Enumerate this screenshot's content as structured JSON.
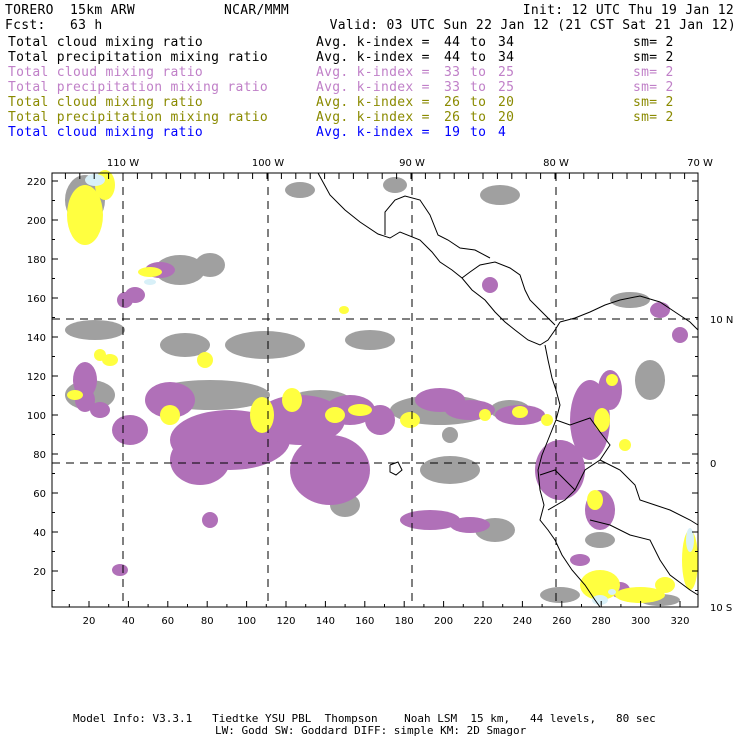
{
  "header": {
    "model": "TORERO  15km ARW",
    "org": "NCAR/MMM",
    "init": "Init: 12 UTC Thu 19 Jan 12",
    "fcst": "Fcst:   63 h",
    "valid": "Valid: 03 UTC Sun 22 Jan 12 (21 CST Sat 21 Jan 12)"
  },
  "legend": [
    {
      "field": "Total cloud mixing ratio",
      "avg": "Avg. k-index =",
      "from": "44",
      "to_word": "to",
      "to": "34",
      "sm": "sm= 2",
      "color": "#000000"
    },
    {
      "field": "Total precipitation mixing ratio",
      "avg": "Avg. k-index =",
      "from": "44",
      "to_word": "to",
      "to": "34",
      "sm": "sm= 2",
      "color": "#000000"
    },
    {
      "field": "Total cloud mixing ratio",
      "avg": "Avg. k-index =",
      "from": "33",
      "to_word": "to",
      "to": "25",
      "sm": "sm= 2",
      "color": "#c080c8"
    },
    {
      "field": "Total precipitation mixing ratio",
      "avg": "Avg. k-index =",
      "from": "33",
      "to_word": "to",
      "to": "25",
      "sm": "sm= 2",
      "color": "#c080c8"
    },
    {
      "field": "Total cloud mixing ratio",
      "avg": "Avg. k-index =",
      "from": "26",
      "to_word": "to",
      "to": "20",
      "sm": "sm= 2",
      "color": "#8a8a00"
    },
    {
      "field": "Total precipitation mixing ratio",
      "avg": "Avg. k-index =",
      "from": "26",
      "to_word": "to",
      "to": "20",
      "sm": "sm= 2",
      "color": "#8a8a00"
    },
    {
      "field": "Total cloud mixing ratio",
      "avg": "Avg. k-index =",
      "from": "19",
      "to_word": "to",
      "to": "4",
      "sm": "",
      "color": "#0000ff"
    }
  ],
  "map": {
    "lon_labels": [
      "110 W",
      "100 W",
      "90 W",
      "80 W",
      "70 W"
    ],
    "lat_labels": [
      "10 N",
      "0",
      "10 S"
    ],
    "x_ticks": [
      "20",
      "40",
      "60",
      "80",
      "100",
      "120",
      "140",
      "160",
      "180",
      "200",
      "220",
      "240",
      "260",
      "280",
      "300",
      "320"
    ],
    "y_ticks": [
      "20",
      "40",
      "60",
      "80",
      "100",
      "120",
      "140",
      "160",
      "180",
      "200",
      "220"
    ],
    "colors": {
      "gray": "#a0a0a0",
      "purple": "#b070b8",
      "yellow": "#ffff40",
      "cyan": "#d8f0f8"
    }
  },
  "footer": {
    "line1": "Model Info: V3.3.1   Tiedtke YSU PBL  Thompson    Noah LSM  15 km,   44 levels,   80 sec",
    "line2": "LW: Godd SW: Goddard DIFF: simple KM: 2D Smagor"
  }
}
